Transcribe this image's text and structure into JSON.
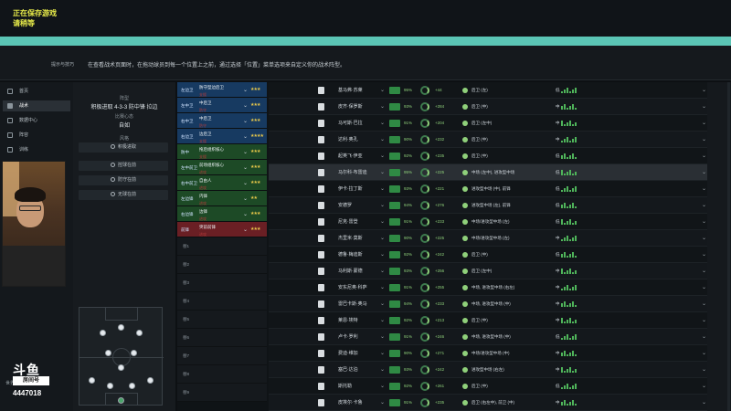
{
  "save": {
    "line1": "正在保存游戏",
    "line2": "请稍等",
    "progress_pct": 100
  },
  "tip": {
    "label": "提示与技巧",
    "text": "在查看战术页面时，在拖动球员到每一个位置上之前，通过选择「位置」菜单选项来自定义你的战术阵型。"
  },
  "nav": {
    "items": [
      "首页",
      "战术",
      "数据中心",
      "阵容",
      "训练"
    ],
    "active": 1,
    "world": "世界中心"
  },
  "stream": {
    "logo": "斗鱼",
    "logo_sub": "房间号",
    "room": "4447018"
  },
  "tactic": {
    "formation_label": "阵型",
    "formation_value": "积极进取 4-3-3 防中锋 拉边",
    "mentality_label": "比赛心态",
    "mentality_value": "自如",
    "style_label": "风格",
    "style_value": "积极进取",
    "buttons": [
      "控球在前",
      "防守在前",
      "无球在前"
    ]
  },
  "roles": [
    {
      "pos": "左边卫",
      "name": "防守型边后卫",
      "duty": "支援",
      "stars": "★★★",
      "color": "blue"
    },
    {
      "pos": "左中卫",
      "name": "中后卫",
      "duty": "防守",
      "stars": "★★★",
      "color": "blue"
    },
    {
      "pos": "右中卫",
      "name": "中后卫",
      "duty": "防守",
      "stars": "★★★",
      "color": "blue"
    },
    {
      "pos": "右边卫",
      "name": "边后卫",
      "duty": "支援",
      "stars": "★★★★",
      "color": "blue"
    },
    {
      "pos": "防中",
      "name": "拖后组织核心",
      "duty": "支援",
      "stars": "★★★",
      "color": "green"
    },
    {
      "pos": "左中前卫",
      "name": "前场组织核心",
      "duty": "进攻",
      "stars": "★★★",
      "color": "green"
    },
    {
      "pos": "右中前卫",
      "name": "自由人",
      "duty": "进攻",
      "stars": "★★★",
      "color": "green"
    },
    {
      "pos": "左边锋",
      "name": "内锋",
      "duty": "进攻",
      "stars": "★★",
      "color": "green"
    },
    {
      "pos": "右边锋",
      "name": "边锋",
      "duty": "进攻",
      "stars": "★★★",
      "color": "green"
    },
    {
      "pos": "前锋",
      "name": "突前前锋",
      "duty": "进攻",
      "stars": "★★★",
      "color": "red"
    }
  ],
  "subs": [
    "替1",
    "替2",
    "替3",
    "替4",
    "替5",
    "替6",
    "替7",
    "替8",
    "替9"
  ],
  "players": [
    {
      "idx": "",
      "name": "基马弗·苏莱",
      "pct": "95%",
      "rt": "+44",
      "pos": "后卫 (左)",
      "side": "低"
    },
    {
      "idx": "",
      "name": "皮齐·保罗斯",
      "pct": "93%",
      "rt": "+284",
      "pos": "后卫 (中)",
      "side": "中"
    },
    {
      "idx": "",
      "name": "马可斯·巴拉",
      "pct": "91%",
      "rt": "+204",
      "pos": "后卫 (左中)",
      "side": "中"
    },
    {
      "idx": "",
      "name": "达利·奥孔",
      "pct": "90%",
      "rt": "+232",
      "pos": "后卫 (中)",
      "side": "中"
    },
    {
      "idx": "",
      "name": "起英飞·伊亚",
      "pct": "92%",
      "rt": "+235",
      "pos": "后卫 (中)",
      "side": "低"
    },
    {
      "idx": "",
      "name": "马尔科·布雷迪",
      "pct": "95%",
      "rt": "+225",
      "pos": "中场 (左中), 进攻型中场",
      "side": "低"
    },
    {
      "idx": "",
      "name": "伊卡·拉丁斯",
      "pct": "93%",
      "rt": "+221",
      "pos": "进攻型中场 (中), 前锋",
      "side": "低"
    },
    {
      "idx": "",
      "name": "安德罗",
      "pct": "94%",
      "rt": "+276",
      "pos": "进攻型中场 (左), 前锋",
      "side": "低"
    },
    {
      "idx": "",
      "name": "尼克·雷登",
      "pct": "91%",
      "rt": "+233",
      "pos": "中场/进攻型中场 (左)",
      "side": "低"
    },
    {
      "idx": "",
      "name": "杰里米·莫斯",
      "pct": "90%",
      "rt": "+225",
      "pos": "中场/进攻型中场 (左)",
      "side": "中"
    },
    {
      "idx": "",
      "name": "德鲁·梅迪斯",
      "pct": "92%",
      "rt": "+242",
      "pos": "后卫 (中)",
      "side": "低"
    },
    {
      "idx": "",
      "name": "马利斯·蒙德",
      "pct": "93%",
      "rt": "+256",
      "pos": "后卫 (左中)",
      "side": "中"
    },
    {
      "idx": "",
      "name": "安东尼奥·科萨",
      "pct": "91%",
      "rt": "+255",
      "pos": "中场, 进攻型中场 (右左)",
      "side": "中"
    },
    {
      "idx": "",
      "name": "雷巴卡斯·奥马",
      "pct": "94%",
      "rt": "+233",
      "pos": "中场, 进攻型中场 (中)",
      "side": "中"
    },
    {
      "idx": "",
      "name": "莱恩·埃特",
      "pct": "92%",
      "rt": "+213",
      "pos": "后卫 (中)",
      "side": "中"
    },
    {
      "idx": "",
      "name": "卢卡·罗利",
      "pct": "91%",
      "rt": "+246",
      "pos": "中场, 进攻型中场 (中)",
      "side": "低"
    },
    {
      "idx": "",
      "name": "费迪·维加",
      "pct": "90%",
      "rt": "+271",
      "pos": "中场/进攻型中场 (中)",
      "side": "中"
    },
    {
      "idx": "",
      "name": "塞巴·达泊",
      "pct": "93%",
      "rt": "+242",
      "pos": "进攻型中场 (右左)",
      "side": "中"
    },
    {
      "idx": "",
      "name": "斯托勒",
      "pct": "92%",
      "rt": "+261",
      "pos": "后卫 (中)",
      "side": "低"
    },
    {
      "idx": "",
      "name": "皮埃尔·卡鲁",
      "pct": "91%",
      "rt": "+235",
      "pos": "后卫 (右左中), 前卫 (中)",
      "side": "中"
    }
  ],
  "colors": {
    "accent": "#5bc5b5",
    "save_text": "#e8ec4a",
    "blue": "#173a61",
    "green": "#1d4a26",
    "red": "#6a1f24"
  }
}
